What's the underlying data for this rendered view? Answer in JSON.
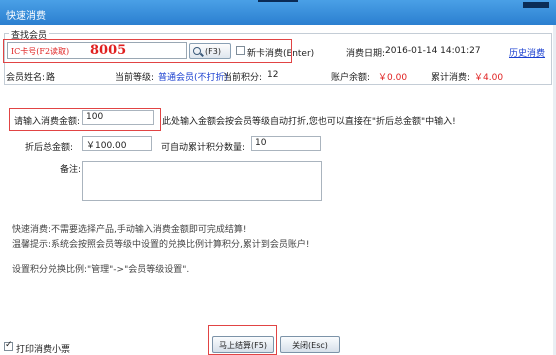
{
  "window": {
    "title": "快速消费"
  },
  "search": {
    "group_label": "查找会员",
    "card_hint": "IC卡号(F2读取)",
    "card_value": "8005",
    "search_button": "(F3)",
    "new_card_label": "新卡消费(Enter)",
    "new_card_checked": false,
    "date_label": "消费日期:",
    "date_value": "2016-01-14 14:01:27",
    "history_link": "历史消费"
  },
  "member": {
    "name_label": "会员姓名:",
    "name_value": "路",
    "level_label": "当前等级:",
    "level_value": "普通会员(不打折)",
    "points_label": "当前积分:",
    "points_value": "12",
    "balance_label": "账户余额:",
    "balance_value": "￥0.00",
    "total_label": "累计消费:",
    "total_value": "￥4.00"
  },
  "form": {
    "amount_label": "请输入消费金额:",
    "amount_value": "100",
    "amount_hint": "此处输入金额会按会员等级自动打折,您也可以直接在\"折后总金额\"中输入!",
    "discounted_label": "折后总金额:",
    "discounted_value": "￥100.00",
    "points_label": "可自动累计积分数量:",
    "points_value": "10",
    "remark_label": "备注:",
    "remark_value": ""
  },
  "notes": {
    "line1": "快速消费:不需要选择产品,手动输入消费金额即可完成结算!",
    "line2": "温馨提示:系统会按照会员等级中设置的兑换比例计算积分,累计到会员账户!",
    "line3": "设置积分兑换比例:\"管理\"->\"会员等级设置\"."
  },
  "footer": {
    "print_label": "打印消费小票",
    "print_checked": true,
    "checkout_button": "马上结算(F5)",
    "close_button": "关闭(Esc)"
  }
}
